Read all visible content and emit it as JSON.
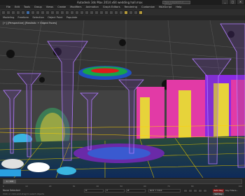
{
  "app": {
    "title": "Autodesk 3ds Max 2014 x64   wedding hall.max",
    "search_placeholder": "Type a keyword or phrase",
    "window_buttons": [
      "_",
      "□",
      "✕"
    ]
  },
  "menu": [
    "File",
    "Edit",
    "Tools",
    "Group",
    "Views",
    "Create",
    "Modifiers",
    "Animation",
    "Graph Editors",
    "Rendering",
    "Customize",
    "MAXScript",
    "Help"
  ],
  "ribbon": [
    "Modeling",
    "Freeform",
    "Selection",
    "Object Paint",
    "Populate"
  ],
  "viewport": {
    "label": "[+] [Perspective] [Realistic + Edged Faces]",
    "colors": {
      "pillar": "#b37cff",
      "carpet": "#8a2be2",
      "curtain_pink": "#e23aa6",
      "curtain_yellow": "#e7d33a",
      "grid": "#d4b800",
      "ceiling_oval": "#18a34a"
    }
  },
  "timeline": {
    "slider_label": "0 / 100",
    "ticks": [
      "0",
      "10",
      "20",
      "30",
      "40",
      "50",
      "60",
      "70",
      "80",
      "90",
      "100"
    ]
  },
  "status": {
    "line1": "None Selected",
    "line2": "Click or click-and-drag to select objects",
    "x_label": "X:",
    "y_label": "Y:",
    "z_label": "Z:",
    "grid_label": "Grid = 10.0",
    "auto_key": "Auto Key",
    "set_key": "Set Key",
    "key_filters": "Key Filters..."
  }
}
